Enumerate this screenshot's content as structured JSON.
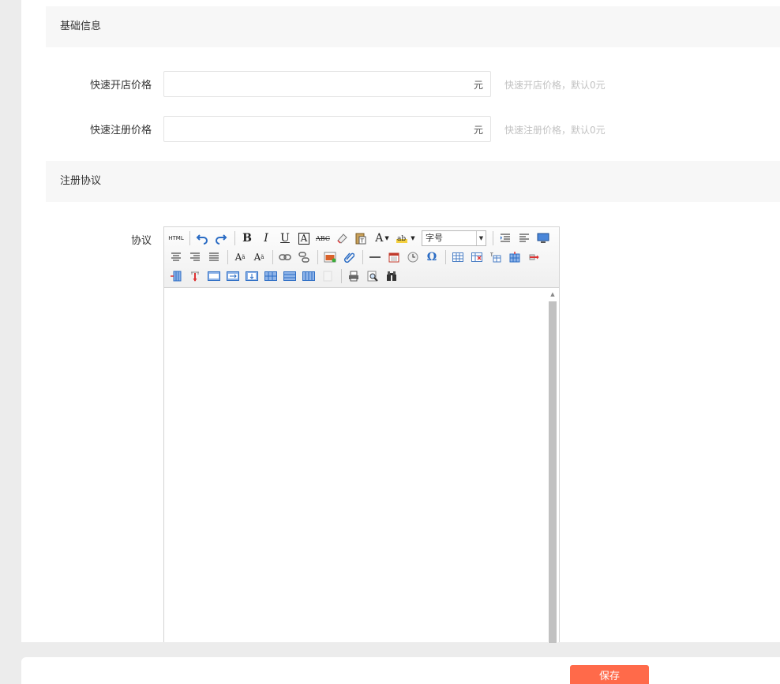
{
  "sections": {
    "basic": {
      "title": "基础信息"
    },
    "agreement": {
      "title": "注册协议"
    }
  },
  "fields": {
    "quick_open": {
      "label": "快速开店价格",
      "value": "",
      "placeholder": "",
      "unit": "元",
      "hint": "快速开店价格，默认0元"
    },
    "quick_register": {
      "label": "快速注册价格",
      "value": "",
      "placeholder": "",
      "unit": "元",
      "hint": "快速注册价格，默认0元"
    }
  },
  "editor": {
    "label": "协议",
    "html_button": "HTML",
    "fontsize_value": "字号",
    "content": ""
  },
  "footer": {
    "save_label": "保存"
  },
  "colors": {
    "accent": "#ff6a4a",
    "section_bg": "#f7f7f7",
    "hint": "#c2c2c2"
  }
}
